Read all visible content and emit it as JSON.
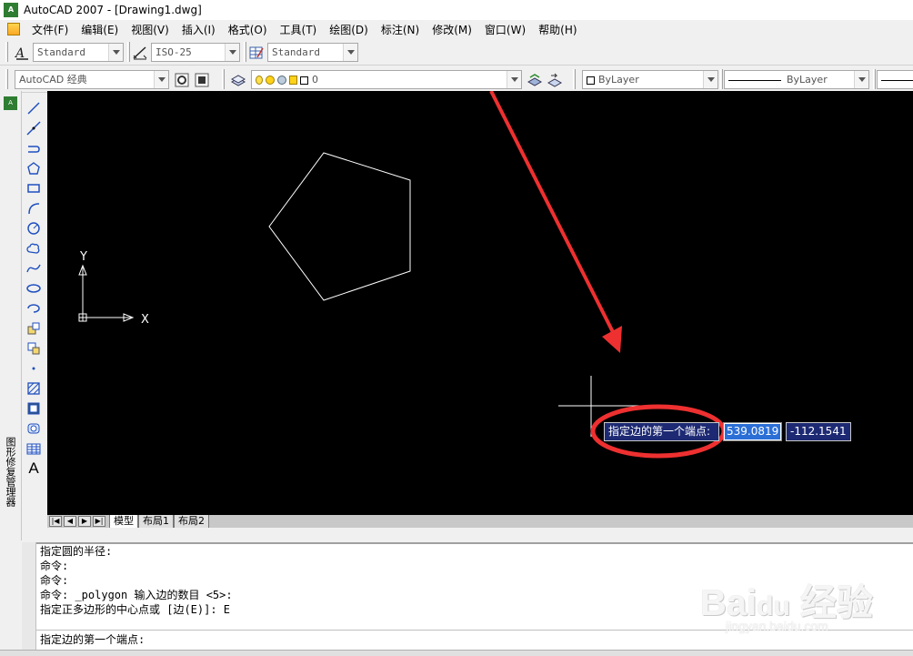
{
  "window": {
    "title": "AutoCAD 2007 - [Drawing1.dwg]"
  },
  "menu": {
    "items": [
      "文件(F)",
      "编辑(E)",
      "视图(V)",
      "插入(I)",
      "格式(O)",
      "工具(T)",
      "绘图(D)",
      "标注(N)",
      "修改(M)",
      "窗口(W)",
      "帮助(H)"
    ]
  },
  "styles_toolbar": {
    "text_style": "Standard",
    "dim_style": "ISO-25",
    "table_style": "Standard"
  },
  "workspace_toolbar": {
    "workspace": "AutoCAD 经典",
    "layer_value": "0",
    "color": "ByLayer",
    "linetype": "ByLayer"
  },
  "left_panel": {
    "label": "图形修复管理器"
  },
  "draw_tools": [
    "line",
    "construction-line",
    "polyline",
    "polygon",
    "rectangle",
    "arc",
    "circle",
    "revision-cloud",
    "spline",
    "ellipse",
    "ellipse-arc",
    "insert-block",
    "make-block",
    "point",
    "hatch",
    "gradient",
    "region",
    "table",
    "multiline-text"
  ],
  "canvas": {
    "ucs_x_label": "X",
    "ucs_y_label": "Y"
  },
  "dynamic_input": {
    "prompt": "指定边的第一个端点:",
    "x_value": "539.0819",
    "y_value": "-112.1541"
  },
  "layout_tabs": [
    "模型",
    "布局1",
    "布局2"
  ],
  "command_history": [
    "指定圆的半径:",
    "命令:",
    "命令:",
    "命令: _polygon 输入边的数目 <5>:",
    "指定正多边形的中心点或 [边(E)]: E"
  ],
  "command_current": "指定边的第一个端点:",
  "colors": {
    "canvas_bg": "#000000",
    "entity": "#ffffff",
    "annotation_red": "#ee3030",
    "tooltip_bg": "#1d2a73",
    "highlight": "#2b6fd6"
  }
}
